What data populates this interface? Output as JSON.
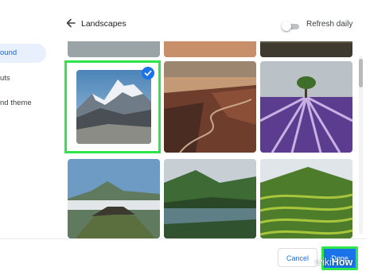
{
  "sidebar": {
    "items": [
      {
        "label": "ound",
        "active": true
      },
      {
        "label": "uts",
        "active": false
      },
      {
        "label": "nd theme",
        "active": false
      }
    ]
  },
  "header": {
    "back_icon": "arrow-left-icon",
    "title": "Landscapes",
    "toggle": {
      "label": "Refresh daily",
      "on": false
    }
  },
  "grid": {
    "selected_index": 0,
    "images": [
      {
        "name": "snowy-mountain-peak",
        "selected": true
      },
      {
        "name": "desert-canyon-road",
        "selected": false
      },
      {
        "name": "lavender-field-tree",
        "selected": false
      },
      {
        "name": "volcano-crater-clouds",
        "selected": false
      },
      {
        "name": "river-valley-hills",
        "selected": false
      },
      {
        "name": "rice-terraces",
        "selected": false
      }
    ]
  },
  "footer": {
    "cancel_label": "Cancel",
    "done_label": "Done"
  },
  "watermark": {
    "part1": "wiki",
    "part2": "How"
  },
  "colors": {
    "accent": "#1a73e8",
    "highlight": "#2ee54a"
  }
}
